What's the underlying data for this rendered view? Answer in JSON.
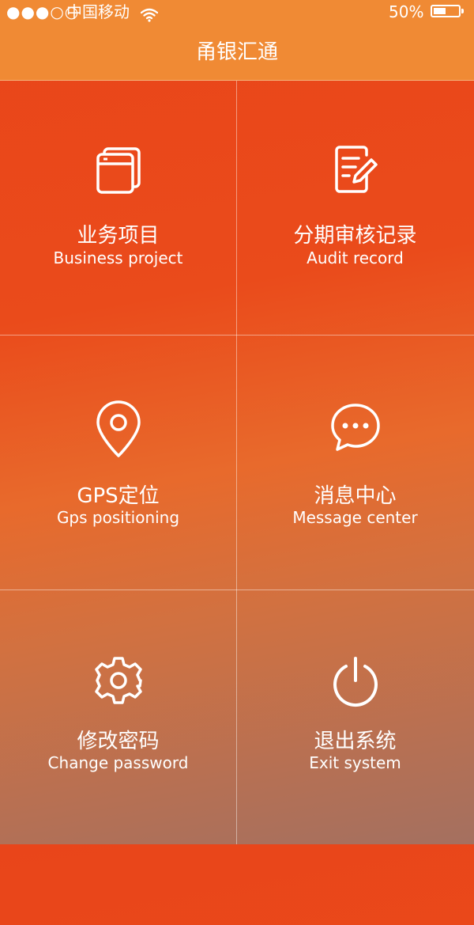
{
  "status_bar": {
    "signal": "●●●○○",
    "carrier": "中国移动",
    "battery_percent": "50%",
    "battery_level": 0.5
  },
  "header": {
    "title": "甬银汇通"
  },
  "menu": [
    {
      "cn": "业务项目",
      "en": "Business project",
      "icon": "browser-window-icon"
    },
    {
      "cn": "分期审核记录",
      "en": "Audit record",
      "icon": "document-edit-icon"
    },
    {
      "cn": "GPS定位",
      "en": "Gps positioning",
      "icon": "map-pin-icon"
    },
    {
      "cn": "消息中心",
      "en": "Message center",
      "icon": "chat-bubble-icon"
    },
    {
      "cn": "修改密码",
      "en": "Change password",
      "icon": "gear-icon"
    },
    {
      "cn": "退出系统",
      "en": "Exit system",
      "icon": "power-icon"
    }
  ],
  "colors": {
    "header_bg": "#f08a34",
    "primary_orange": "#e9451a",
    "text": "#ffffff"
  }
}
